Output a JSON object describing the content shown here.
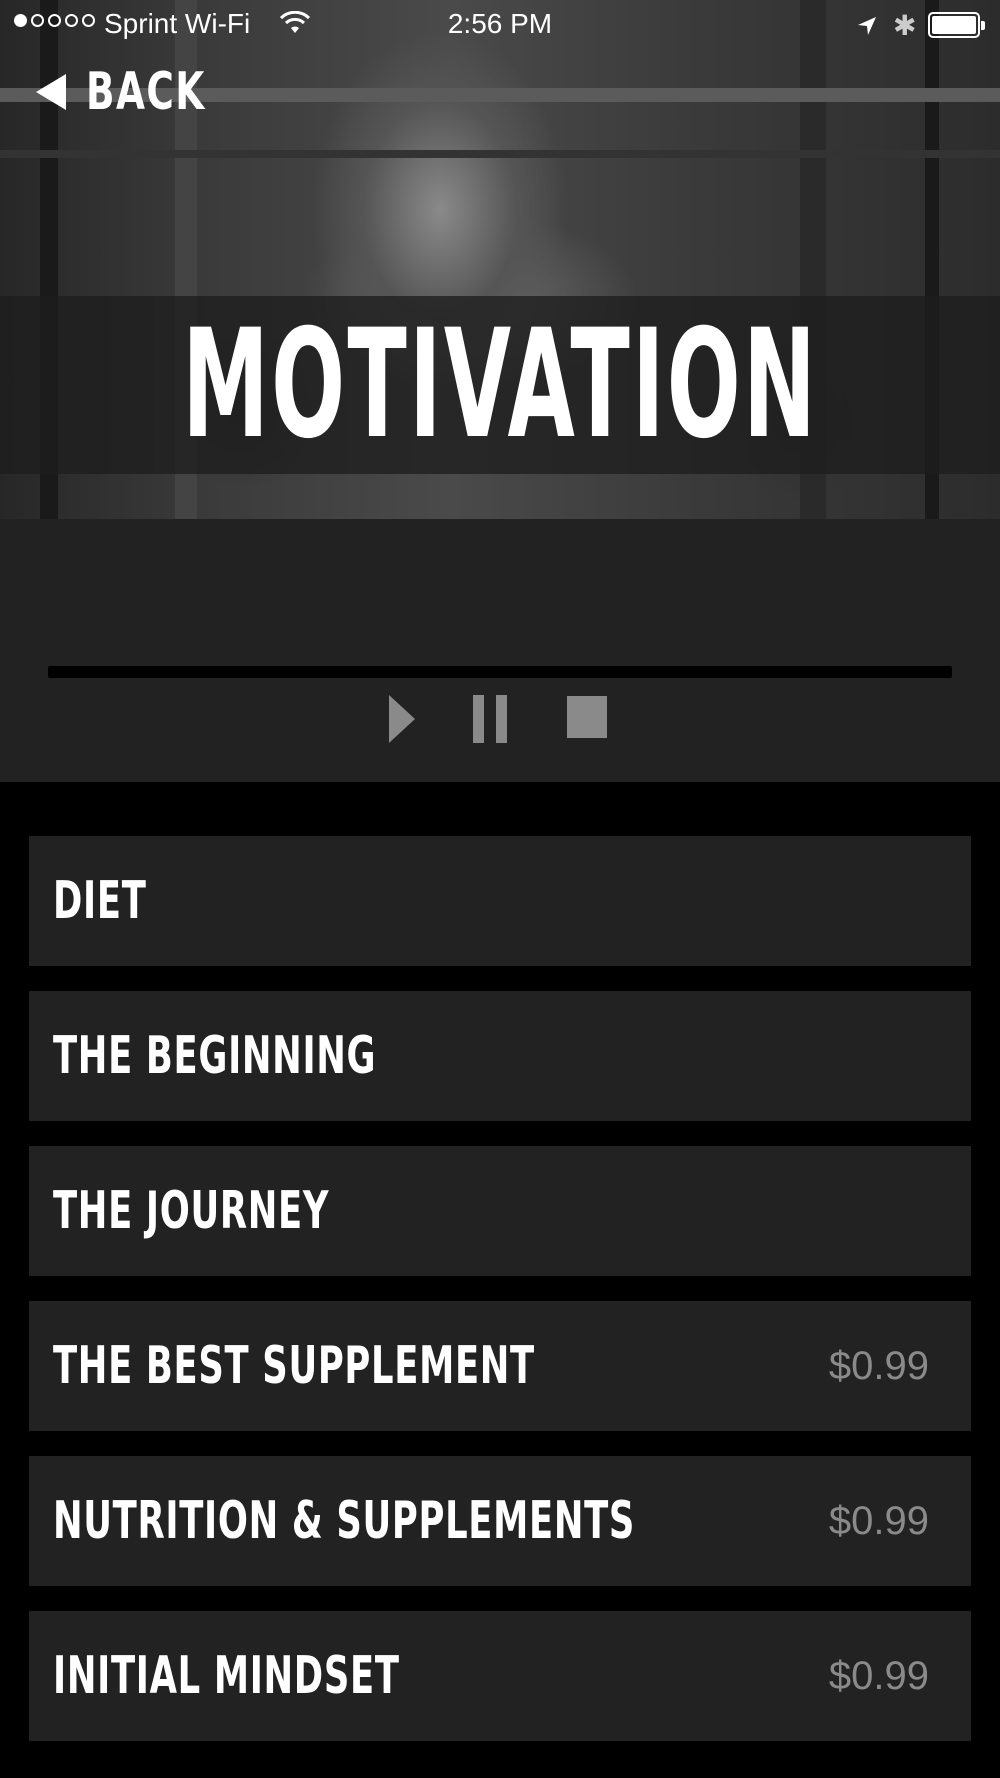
{
  "status_bar": {
    "signal_dots": [
      true,
      false,
      false,
      false,
      false
    ],
    "carrier": "Sprint Wi-Fi",
    "time": "2:56 PM",
    "icons": [
      "wifi-icon",
      "location-icon",
      "bluetooth-icon",
      "battery-icon"
    ]
  },
  "nav": {
    "back_label": "BACK"
  },
  "header": {
    "title": "MOTIVATION"
  },
  "player": {
    "progress": 0,
    "controls": [
      "play-icon",
      "pause-icon",
      "stop-icon"
    ]
  },
  "list": {
    "items": [
      {
        "name": "DIET",
        "price": ""
      },
      {
        "name": "THE BEGINNING",
        "price": ""
      },
      {
        "name": "THE JOURNEY",
        "price": ""
      },
      {
        "name": "THE BEST SUPPLEMENT",
        "price": "$0.99"
      },
      {
        "name": "NUTRITION & SUPPLEMENTS",
        "price": "$0.99"
      },
      {
        "name": "INITIAL MINDSET",
        "price": "$0.99"
      }
    ]
  },
  "colors": {
    "background": "#000000",
    "panel": "#222222",
    "muted": "#8a8a8a",
    "text": "#ffffff"
  }
}
